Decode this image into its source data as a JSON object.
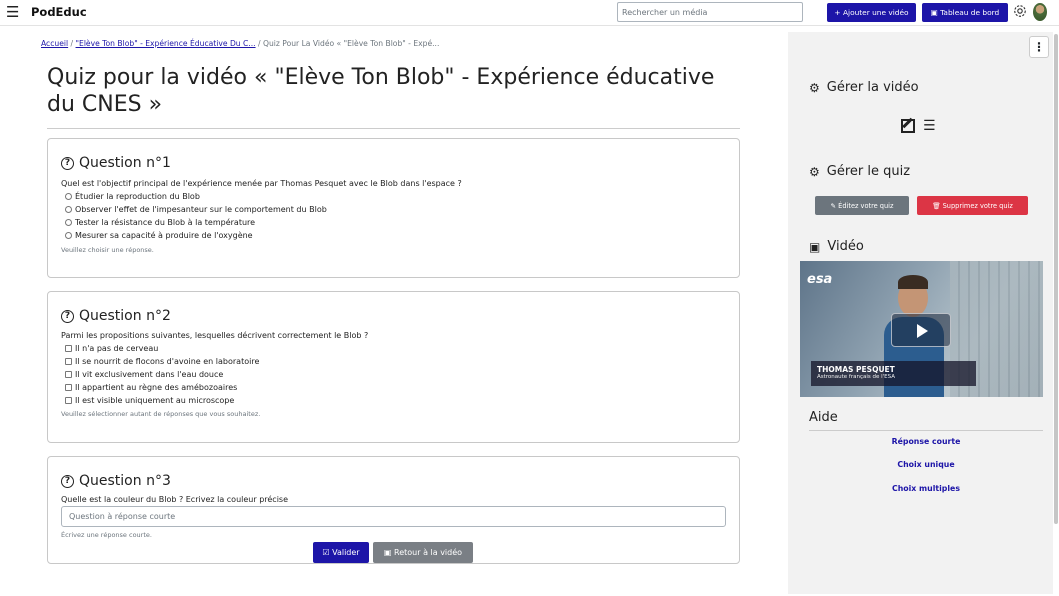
{
  "topbar": {
    "brand": "PodEduc",
    "search_placeholder": "Rechercher un média",
    "add_video_label": "+ Ajouter une vidéo",
    "dashboard_label": "Tableau de bord"
  },
  "breadcrumb": {
    "home": "Accueil",
    "video": "\"Elève Ton Blob\" - Expérience Éducative Du C...",
    "current": "Quiz Pour La Vidéo « \"Elève Ton Blob\" - Expé..."
  },
  "page_title": "Quiz pour la vidéo « \"Elève Ton Blob\" - Expérience éducative du CNES »",
  "questions": [
    {
      "heading": "Question n°1",
      "text": "Quel est l'objectif principal de l'expérience menée par Thomas Pesquet avec le Blob dans l'espace ?",
      "options": [
        "Étudier la reproduction du Blob",
        "Observer l'effet de l'impesanteur sur le comportement du Blob",
        "Tester la résistance du Blob à la température",
        "Mesurer sa capacité à produire de l'oxygène"
      ],
      "hint": "Veuillez choisir une réponse."
    },
    {
      "heading": "Question n°2",
      "text": "Parmi les propositions suivantes, lesquelles décrivent correctement le Blob ?",
      "options": [
        "Il n'a pas de cerveau",
        "Il se nourrit de flocons d'avoine en laboratoire",
        "Il vit exclusivement dans l'eau douce",
        "Il appartient au règne des amébozoaires",
        "Il est visible uniquement au microscope"
      ],
      "hint": "Veuillez sélectionner autant de réponses que vous souhaitez."
    },
    {
      "heading": "Question n°3",
      "text": "Quelle est la couleur du Blob ? Ecrivez la couleur précise",
      "placeholder": "Question à réponse courte",
      "hint": "Écrivez une réponse courte."
    }
  ],
  "actions": {
    "validate": "Valider",
    "return": "Retour à la vidéo"
  },
  "sidebar": {
    "manage_video": "Gérer la vidéo",
    "manage_quiz": "Gérer le quiz",
    "edit_quiz": "Éditez votre quiz",
    "delete_quiz": "Supprimez votre quiz",
    "video_heading": "Vidéo",
    "video_overlay_name": "THOMAS PESQUET",
    "video_overlay_role": "Astronaute français de l'ESA",
    "video_logo": "esa",
    "help_heading": "Aide",
    "help_links": [
      "Réponse courte",
      "Choix unique",
      "Choix multiples"
    ]
  },
  "colors": {
    "primary": "#1d15a8",
    "secondary": "#6c757d",
    "danger": "#dc3545"
  }
}
